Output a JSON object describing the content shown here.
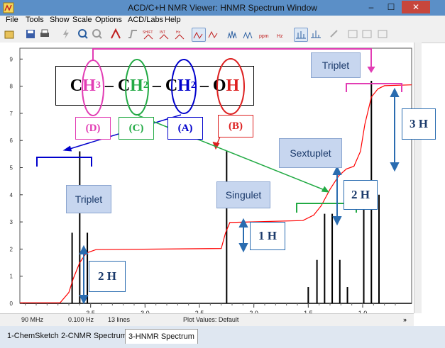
{
  "window": {
    "title": "ACD/C+H NMR Viewer: HNMR Spectrum Window"
  },
  "menu": [
    "File",
    "Tools",
    "Show",
    "Scale",
    "Options",
    "ACD/Labs",
    "Help"
  ],
  "toolbar": {
    "shift_label": "SHIFT",
    "int_label": "INT",
    "hz_label": "Hz",
    "ppm_label": "ppm"
  },
  "status": {
    "freq": "90 MHz",
    "resolution": "0.100 Hz",
    "lines": "13 lines",
    "plot_values": "Plot Values: Default",
    "scroll_arrow": "»"
  },
  "tabs": [
    {
      "label": "1-ChemSketch"
    },
    {
      "label": "2-CNMR Spectrum"
    },
    {
      "label": "3-HNMR Spectrum"
    }
  ],
  "formula": {
    "text": "CH3 – CH2 – CH2 – OH",
    "parts": [
      "C",
      "H",
      "3",
      " – C",
      "H",
      "2",
      " – C",
      "H",
      "2",
      " – O",
      "H"
    ]
  },
  "group_labels": {
    "d": "(D)",
    "c": "(C)",
    "a": "(A)",
    "b": "(B)"
  },
  "callouts": {
    "triplet_top": "Triplet",
    "triplet_left": "Triplet",
    "singulet": "Singulet",
    "sextuplet": "Sextuplet",
    "h2_left": "2 H",
    "h1": "1 H",
    "h2_right": "2 H",
    "h3": "3 H"
  },
  "colors": {
    "spectrum": "#000000",
    "integral": "#ff0000",
    "d_group": "#e23cb4",
    "c_group": "#22aa44",
    "a_group": "#0000cc",
    "b_group": "#dd2020",
    "arrow_blue": "#2a6cb0"
  },
  "chart_data": {
    "type": "line",
    "x_ticks": [
      "3.5",
      "3.0",
      "2.5",
      "2.0",
      "1.5",
      "1.0"
    ],
    "y_ticks": [
      "0",
      "1",
      "2",
      "3",
      "4",
      "5",
      "6",
      "7",
      "8",
      "9"
    ],
    "xlim": [
      4.15,
      0.55
    ],
    "ylim": [
      0,
      9.4
    ],
    "peaks": [
      {
        "ppm": 3.67,
        "height": 2.6
      },
      {
        "ppm": 3.6,
        "height": 5.6
      },
      {
        "ppm": 3.53,
        "height": 2.6
      },
      {
        "ppm": 2.25,
        "height": 5.6
      },
      {
        "ppm": 1.5,
        "height": 0.6
      },
      {
        "ppm": 1.42,
        "height": 1.6
      },
      {
        "ppm": 1.35,
        "height": 3.3
      },
      {
        "ppm": 1.28,
        "height": 3.3
      },
      {
        "ppm": 1.21,
        "height": 1.6
      },
      {
        "ppm": 1.14,
        "height": 0.6
      },
      {
        "ppm": 0.99,
        "height": 4.0
      },
      {
        "ppm": 0.92,
        "height": 8.2
      },
      {
        "ppm": 0.85,
        "height": 4.0
      }
    ],
    "integral": [
      [
        4.15,
        0.02
      ],
      [
        3.78,
        0.02
      ],
      [
        3.7,
        0.4
      ],
      [
        3.66,
        0.9
      ],
      [
        3.6,
        1.5
      ],
      [
        3.54,
        1.85
      ],
      [
        3.45,
        1.98
      ],
      [
        2.3,
        2.02
      ],
      [
        2.26,
        2.6
      ],
      [
        2.22,
        2.98
      ],
      [
        1.55,
        3.05
      ],
      [
        1.45,
        3.25
      ],
      [
        1.38,
        3.6
      ],
      [
        1.3,
        4.2
      ],
      [
        1.22,
        4.7
      ],
      [
        1.15,
        4.95
      ],
      [
        1.08,
        5.05
      ],
      [
        1.02,
        5.6
      ],
      [
        0.98,
        6.6
      ],
      [
        0.92,
        7.6
      ],
      [
        0.86,
        7.9
      ],
      [
        0.8,
        8.02
      ],
      [
        0.55,
        8.05
      ]
    ]
  }
}
